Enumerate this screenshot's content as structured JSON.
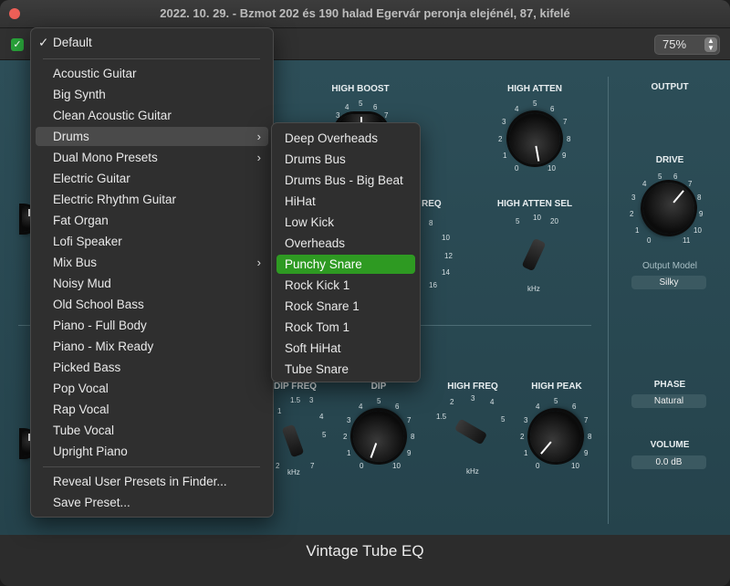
{
  "window": {
    "title": "2022. 10. 29. - Bzmot 202 és 190 halad Egervár peronja elejénél, 87, kifelé"
  },
  "toolbar": {
    "zoom": "75%"
  },
  "plugin": {
    "name": "Vintage Tube EQ",
    "top_section": {
      "high_boost": {
        "label": "HIGH BOOST",
        "ticks": [
          "3",
          "4",
          "5",
          "6",
          "7"
        ]
      },
      "high_atten": {
        "label": "HIGH ATTEN",
        "ticks": [
          "0",
          "1",
          "2",
          "3",
          "4",
          "5",
          "6",
          "7",
          "8",
          "9",
          "10"
        ]
      },
      "freq": {
        "label": "REQ",
        "ticks": [
          "8",
          "10",
          "12",
          "14",
          "16"
        ]
      },
      "high_atten_sel": {
        "label": "HIGH ATTEN SEL",
        "ticks": [
          "5",
          "10",
          "20"
        ],
        "unit": "kHz"
      }
    },
    "output": {
      "label": "OUTPUT",
      "drive": {
        "label": "DRIVE",
        "ticks": [
          "0",
          "1",
          "2",
          "3",
          "4",
          "5",
          "6",
          "7",
          "8",
          "9",
          "10",
          "11"
        ]
      },
      "output_model": {
        "label": "Output Model",
        "value": "Silky"
      },
      "phase": {
        "label": "PHASE",
        "value": "Natural"
      },
      "volume": {
        "label": "VOLUME",
        "value": "0.0 dB"
      }
    },
    "bottom_section": {
      "dip_freq": {
        "label": "DIP FREQ",
        "ticks": [
          "1",
          "1.5",
          "3",
          "4",
          "5",
          "7",
          "2"
        ],
        "unit": "kHz"
      },
      "dip": {
        "label": "DIP",
        "ticks": [
          "0",
          "1",
          "2",
          "3",
          "4",
          "5",
          "6",
          "7",
          "8",
          "9",
          "10"
        ]
      },
      "high_freq": {
        "label": "HIGH FREQ",
        "ticks": [
          "1.5",
          "2",
          "3",
          "4",
          "5"
        ],
        "unit": "kHz"
      },
      "high_peak": {
        "label": "HIGH PEAK",
        "ticks": [
          "0",
          "1",
          "2",
          "3",
          "4",
          "5",
          "6",
          "7",
          "8",
          "9",
          "10"
        ]
      }
    }
  },
  "preset_menu": {
    "default_label": "Default",
    "items": [
      "Acoustic Guitar",
      "Big Synth",
      "Clean Acoustic Guitar",
      "Drums",
      "Dual Mono Presets",
      "Electric Guitar",
      "Electric Rhythm Guitar",
      "Fat Organ",
      "Lofi Speaker",
      "Mix Bus",
      "Noisy Mud",
      "Old School Bass",
      "Piano - Full Body",
      "Piano - Mix Ready",
      "Picked Bass",
      "Pop Vocal",
      "Rap Vocal",
      "Tube Vocal",
      "Upright Piano"
    ],
    "footer_items": [
      "Reveal User Presets in Finder...",
      "Save Preset..."
    ]
  },
  "drums_submenu": {
    "items": [
      "Deep Overheads",
      "Drums Bus",
      "Drums Bus - Big Beat",
      "HiHat",
      "Low Kick",
      "Overheads",
      "Punchy Snare",
      "Rock Kick 1",
      "Rock Snare 1",
      "Rock Tom 1",
      "Soft HiHat",
      "Tube Snare"
    ],
    "selected": "Punchy Snare"
  }
}
